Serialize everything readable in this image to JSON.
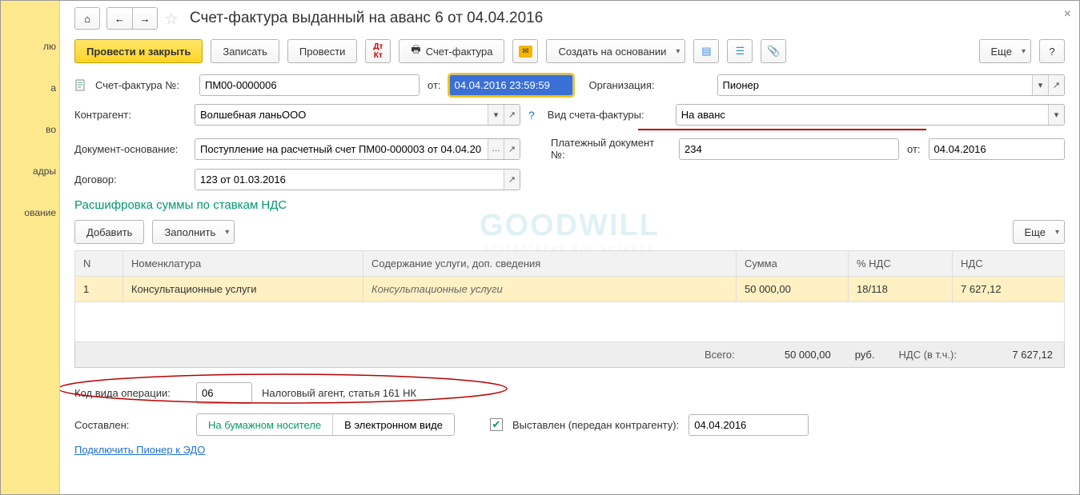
{
  "leftRail": {
    "items": [
      "лю",
      "а",
      "во",
      "адры",
      "ование"
    ]
  },
  "header": {
    "title": "Счет-фактура выданный на аванс 6 от 04.04.2016"
  },
  "toolbar": {
    "post_close": "Провести и закрыть",
    "save": "Записать",
    "post": "Провести",
    "dkt": "Д/К",
    "print": "Счет-фактура",
    "create_based": "Создать на основании",
    "more": "Еще"
  },
  "fields": {
    "sf_no_label": "Счет-фактура №:",
    "sf_no": "ПМ00-0000006",
    "ot_label": "от:",
    "date": "04.04.2016 23:59:59",
    "org_label": "Организация:",
    "org": "Пионер",
    "contr_label": "Контрагент:",
    "contr": "Волшебная ланьООО",
    "type_label": "Вид счета-фактуры:",
    "type": "На аванс",
    "basis_label": "Документ-основание:",
    "basis": "Поступление на расчетный счет ПМ00-000003 от 04.04.20",
    "pay_label": "Платежный документ №:",
    "pay_no": "234",
    "pay_ot": "от:",
    "pay_date": "04.04.2016",
    "contract_label": "Договор:",
    "contract": "123 от 01.03.2016"
  },
  "section_title": "Расшифровка суммы по ставкам НДС",
  "subtoolbar": {
    "add": "Добавить",
    "fill": "Заполнить",
    "more": "Еще"
  },
  "table": {
    "cols": {
      "n": "N",
      "nom": "Номенклатура",
      "desc": "Содержание услуги, доп. сведения",
      "sum": "Сумма",
      "vat": "% НДС",
      "nds": "НДС"
    },
    "rows": [
      {
        "n": "1",
        "nom": "Консультационные услуги",
        "desc": "Консультационные услуги",
        "sum": "50 000,00",
        "vat": "18/118",
        "nds": "7 627,12"
      }
    ]
  },
  "totals": {
    "total_label": "Всего:",
    "total": "50 000,00",
    "rub": "руб.",
    "nds_label": "НДС (в т.ч.):",
    "nds": "7 627,12"
  },
  "opcode": {
    "label": "Код вида операции:",
    "code": "06",
    "desc": "Налоговый агент, статья 161 НК"
  },
  "compose": {
    "label": "Составлен:",
    "paper": "На бумажном носителе",
    "electronic": "В электронном виде",
    "issued_label": "Выставлен (передан контрагенту):",
    "issued_date": "04.04.2016"
  },
  "link_edo": "Подключить Пионер к ЭДО",
  "watermark": "GOODWILL",
  "watermark_sub": "БУХГАЛТЕРИЯ ДЛЯ БИЗНЕСА",
  "icons": {
    "home": "⌂",
    "left": "←",
    "right": "→",
    "star": "☆",
    "cal": "▦",
    "open": "↗",
    "dots": "…",
    "question": "?",
    "check": "✔",
    "play": "▸",
    "down": "▾",
    "x": "×",
    "pin": "📎"
  }
}
